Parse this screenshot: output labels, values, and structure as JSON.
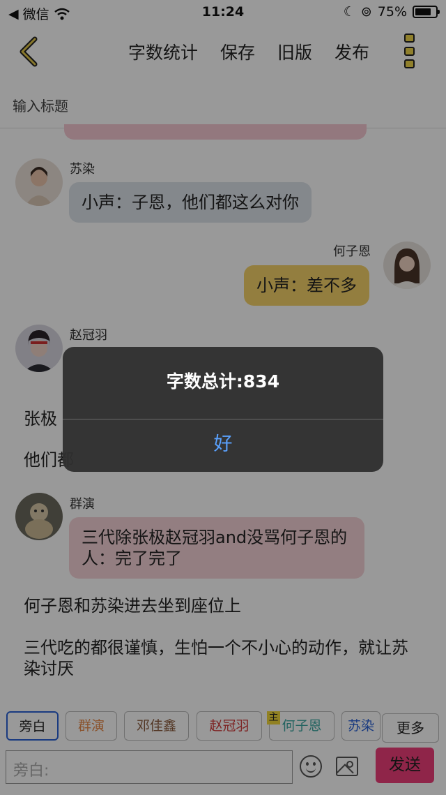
{
  "status_bar": {
    "back_app": "微信",
    "time": "11:24",
    "battery": "75%"
  },
  "toolbar": {
    "word_count": "字数统计",
    "save": "保存",
    "old_version": "旧版",
    "publish": "发布"
  },
  "title_input": {
    "placeholder": "输入标题"
  },
  "messages": [
    {
      "speaker": "苏染",
      "text": "小声：子恩，他们都这么对你"
    },
    {
      "speaker": "何子恩",
      "text": "小声：差不多"
    },
    {
      "speaker": "赵冠羽",
      "text": ""
    },
    {
      "speaker": "群演",
      "text": "三代除张极赵冠羽and没骂何子恩的人：完了完了"
    }
  ],
  "narration": {
    "n1": "张极",
    "n2": "他们都",
    "n3": "何子恩和苏染进去坐到座位上",
    "n4": "三代吃的都很谨慎，生怕一个不小心的动作，就让苏染讨厌"
  },
  "characters": [
    {
      "label": "旁白",
      "color": "#222222"
    },
    {
      "label": "群演",
      "color": "#e6894a"
    },
    {
      "label": "邓佳鑫",
      "color": "#8a5a3c"
    },
    {
      "label": "赵冠羽",
      "color": "#d23d3d"
    },
    {
      "label": "何子恩",
      "color": "#3aa6a0"
    },
    {
      "label": "苏染",
      "color": "#2a62d6"
    }
  ],
  "main_tag": "主",
  "more_button": "更多",
  "composer": {
    "placeholder": "旁白:",
    "send": "发送"
  },
  "dialog": {
    "message": "字数总计:834",
    "ok": "好"
  },
  "colors": {
    "bubble_gray": "#dde3ea",
    "bubble_yellow": "#f6d36a",
    "bubble_pink": "#f6d3d8",
    "send": "#ee3e7a",
    "dialog_button": "#5aa2ff"
  }
}
